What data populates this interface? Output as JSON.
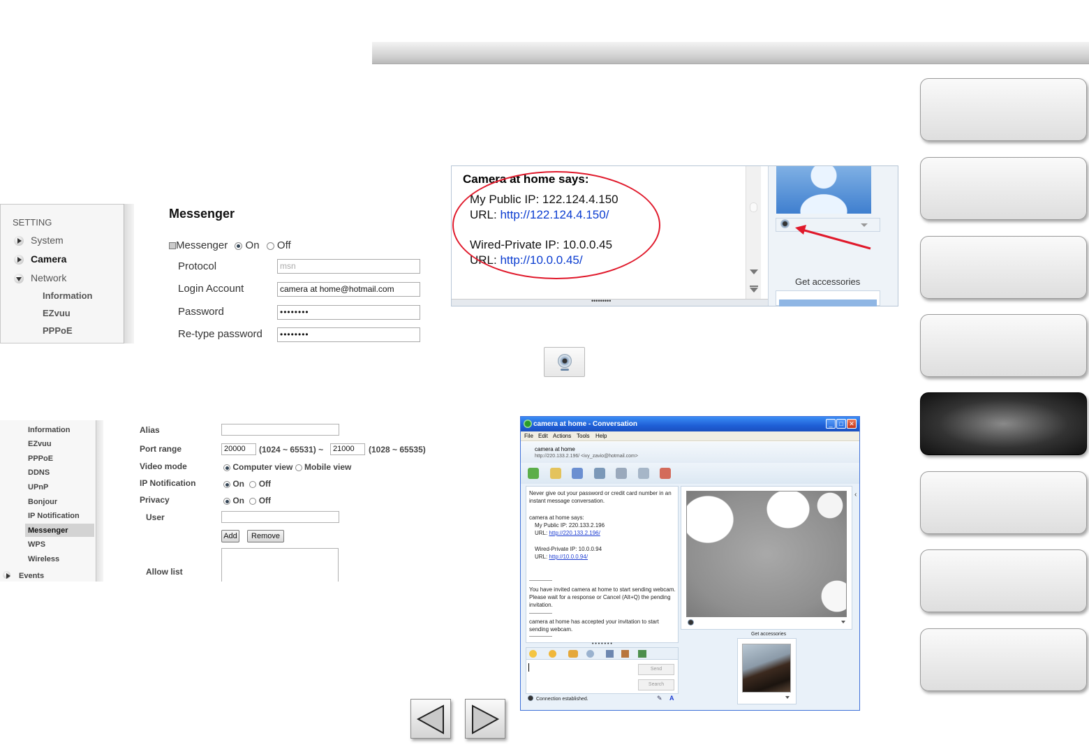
{
  "panel1": {
    "sidebar_heading": "SETTING",
    "items": [
      {
        "label": "System"
      },
      {
        "label": "Camera"
      },
      {
        "label": "Network"
      }
    ],
    "sub_items": [
      "Information",
      "EZvuu",
      "PPPoE"
    ],
    "form": {
      "title": "Messenger",
      "messenger_label": "Messenger",
      "on": "On",
      "off": "Off",
      "protocol_label": "Protocol",
      "protocol_value": "msn",
      "login_label": "Login Account",
      "login_value": "camera at home@hotmail.com",
      "password_label": "Password",
      "password_value": "••••••••",
      "retype_label": "Re-type password",
      "retype_value": "••••••••"
    }
  },
  "panel2": {
    "heading": "Camera at home says:",
    "public_ip": "My Public IP: 122.124.4.150",
    "url_label": "URL: ",
    "public_url": "http://122.124.4.150/",
    "private_ip": "Wired-Private IP: 10.0.0.45",
    "private_url": "http://10.0.0.45/",
    "get_accessories": "Get accessories",
    "dots": "•••••••••",
    "annotation_color": "#e0192b"
  },
  "panel3": {
    "sidebar": [
      "Information",
      "EZvuu",
      "PPPoE",
      "DDNS",
      "UPnP",
      "Bonjour",
      "IP Notification",
      "Messenger",
      "WPS",
      "Wireless"
    ],
    "events": "Events",
    "alias_label": "Alias",
    "port_label": "Port range",
    "port_from": "20000",
    "port_from_range": "(1024 ~ 65531) ~",
    "port_to": "21000",
    "port_to_range": "(1028 ~ 65535)",
    "video_label": "Video mode",
    "video_computer": "Computer view",
    "video_mobile": "Mobile view",
    "ipnotif_label": "IP Notification",
    "privacy_label": "Privacy",
    "on": "On",
    "off": "Off",
    "user_label": "User",
    "add_btn": "Add",
    "remove_btn": "Remove",
    "allow_label": "Allow list"
  },
  "panel4": {
    "title": "camera at home - Conversation",
    "menu": [
      "File",
      "Edit",
      "Actions",
      "Tools",
      "Help"
    ],
    "contact_name": "camera at home",
    "contact_sub": "http://220.133.2.196/ <ivy_zavio@hotmail.com>",
    "warning": "Never give out your password or credit card number in an instant message conversation.",
    "says": "camera at home says:",
    "public_ip": "My Public IP: 220.133.2.196",
    "url_label": "URL: ",
    "public_url": "http://220.133.2.196/",
    "private_ip": "Wired-Private IP: 10.0.0.94",
    "private_url": "http://10.0.0.94/",
    "invited": "You have invited camera at home to start sending webcam. Please wait for a response or Cancel (Alt+Q) the pending invitation.",
    "accepted": "camera at home has accepted your invitation to start sending webcam.",
    "send": "Send",
    "search": "Search",
    "status": "Connection established.",
    "get_accessories": "Get accessories",
    "dots": "• • • • • • •"
  },
  "icons": {
    "webcam": "webcam-icon",
    "prev": "prev-arrow-icon",
    "next": "next-arrow-icon"
  }
}
